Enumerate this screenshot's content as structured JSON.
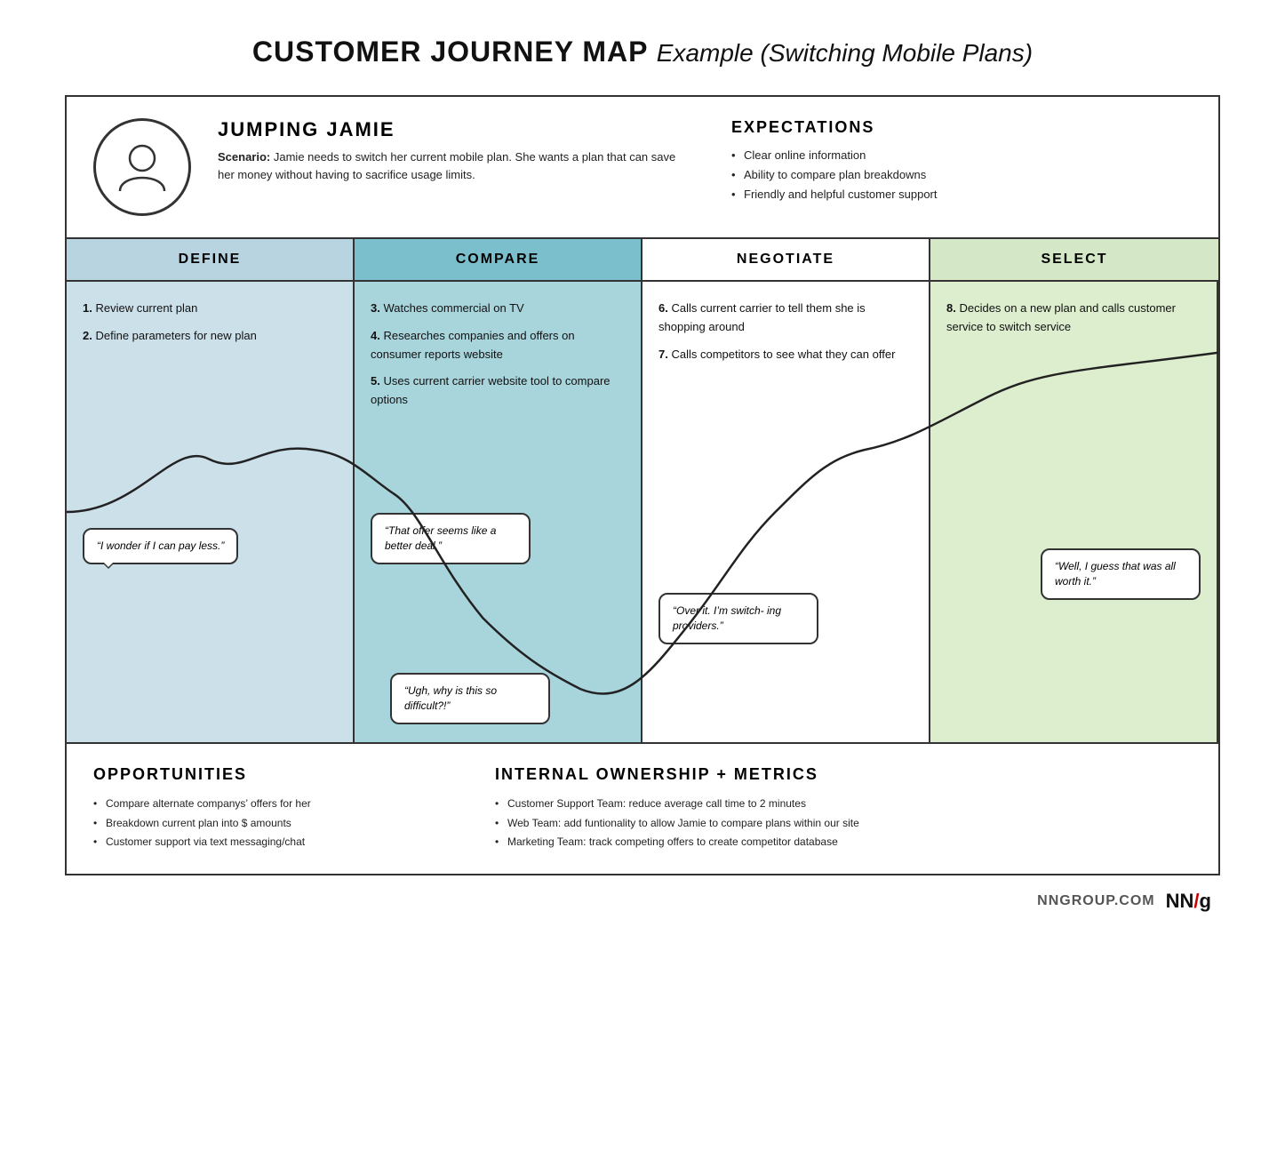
{
  "title": {
    "bold": "CUSTOMER JOURNEY MAP",
    "italic": "Example (Switching Mobile Plans)"
  },
  "persona": {
    "name": "JUMPING JAMIE",
    "scenario_label": "Scenario:",
    "scenario_text": "Jamie needs to switch her current mobile plan. She wants a plan that can save her money without having to sacrifice usage limits."
  },
  "expectations": {
    "title": "EXPECTATIONS",
    "items": [
      "Clear online information",
      "Ability to compare plan breakdowns",
      "Friendly and helpful customer support"
    ]
  },
  "phases": [
    {
      "id": "define",
      "label": "DEFINE"
    },
    {
      "id": "compare",
      "label": "COMPARE"
    },
    {
      "id": "negotiate",
      "label": "NEGOTIATE"
    },
    {
      "id": "select",
      "label": "SELECT"
    }
  ],
  "define_steps": [
    "1. Review current plan",
    "2. Define parameters for new plan"
  ],
  "define_bubble": "“I wonder if I can pay less.”",
  "compare_steps": [
    "3. Watches commercial on TV",
    "4. Researches companies and offers on consumer reports website",
    "5. Uses current carrier website tool to compare options"
  ],
  "compare_bubble_mid": "“That offer seems like a better deal.”",
  "compare_bubble_low": "“Ugh, why is this so difficult?!”",
  "negotiate_steps": [
    "6. Calls current carrier to tell them she is shopping around",
    "7. Calls competitors to see what they can offer"
  ],
  "negotiate_bubble": "“Over it. I’m switch-\ning providers.”",
  "select_steps": [
    "8. Decides on a new plan and calls customer service to switch service"
  ],
  "select_bubble": "“Well, I guess that was all worth it.”",
  "opportunities": {
    "title": "OPPORTUNITIES",
    "items": [
      "Compare alternate companys’ offers for her",
      "Breakdown current plan into $ amounts",
      "Customer support via text messaging/chat"
    ]
  },
  "internal": {
    "title": "INTERNAL OWNERSHIP + METRICS",
    "items": [
      "Customer Support Team: reduce average call time to 2 minutes",
      "Web Team: add funtionality to allow Jamie to compare plans within our site",
      "Marketing Team: track competing offers to create competitor database"
    ]
  },
  "footer": {
    "domain": "NNGROUP.COM",
    "logo_nn": "NN",
    "logo_slash": "/",
    "logo_g": "g"
  }
}
